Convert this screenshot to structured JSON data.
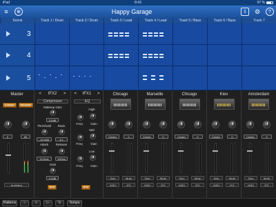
{
  "status": {
    "device": "iPad",
    "wifi": "•",
    "time": "8:43",
    "battery": "97 %"
  },
  "app": {
    "title": "Happy Garage"
  },
  "header": {
    "scene_label": "Scene",
    "tracks": [
      "Track 1 / Drum",
      "Track 2 / Drum",
      "Track 3 / Lead",
      "Track 4 / Lead",
      "Track 5 / Bass",
      "Track 6 / Bass",
      "Track 7"
    ]
  },
  "scenes": [
    {
      "number": "3"
    },
    {
      "number": "4"
    },
    {
      "number": "5"
    }
  ],
  "mixer": {
    "master": {
      "title": "Master",
      "btn_left": "Limiter",
      "btn_right": "Reverb",
      "val_left": "0",
      "val_right": "83",
      "footer": "Audiobus"
    },
    "fx2": {
      "title": "IFX2",
      "nav_prev": "<",
      "nav_next": ">",
      "preset": "Compressor",
      "labels": [
        "Makeup Gain",
        "Threshold",
        "Ratio",
        "Attack",
        "Release",
        "Gain"
      ],
      "values": [
        "0.0dB",
        "-15.0dB",
        "4:1",
        "10.0ms",
        "100ms",
        "0.0dB"
      ],
      "fx_btn": "IFX"
    },
    "fx1": {
      "title": "IFX1",
      "nav_prev": "<",
      "nav_next": ">",
      "preset": "EQ",
      "labels": [
        "High",
        "Freq",
        "Gain",
        "Mid",
        "Freq",
        "Gain",
        "Low",
        "Freq",
        "Gain"
      ],
      "fx_btn": "IFX"
    },
    "channels": [
      {
        "name": "Chicago",
        "gold": false,
        "pan": "Center",
        "vol": "0",
        "solo": "Solo",
        "mute": "Mute",
        "bottom": "MIDI",
        "fx": "IFX"
      },
      {
        "name": "Marseille",
        "gold": false,
        "pan": "Center",
        "vol": "0",
        "solo": "Solo",
        "mute": "Mute",
        "bottom": "MIDI",
        "fx": "IFX"
      },
      {
        "name": "Chicago",
        "gold": false,
        "pan": "Center",
        "vol": "0",
        "solo": "Solo",
        "mute": "Mute",
        "bottom": "MIDI",
        "fx": "IFX"
      },
      {
        "name": "Kiev",
        "gold": true,
        "pan": "Center",
        "vol": "0",
        "solo": "Solo",
        "mute": "Mute",
        "bottom": "MIDI",
        "fx": "IFX"
      },
      {
        "name": "Amsterdam",
        "gold": true,
        "pan": "Center",
        "vol": "0",
        "solo": "Solo",
        "mute": "Mute",
        "bottom": "MIDI",
        "fx": "IFX"
      }
    ]
  },
  "bottombar": {
    "left_label": "Patterns",
    "tempo_label": "Tempo"
  },
  "icons": {
    "menu": "hamburger-icon",
    "globe": "globe-icon",
    "export": "export-icon",
    "settings": "gear-icon",
    "help": "help-icon"
  }
}
